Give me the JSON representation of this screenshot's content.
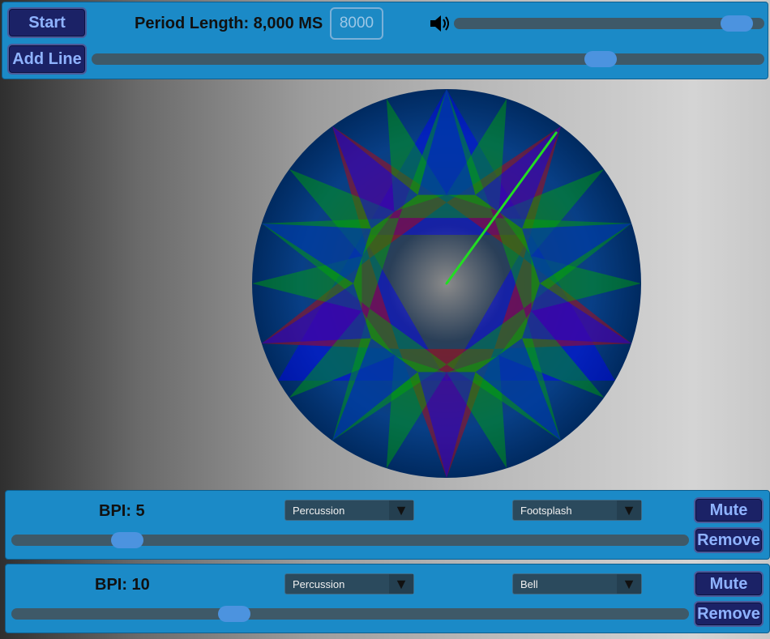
{
  "toolbar": {
    "start_label": "Start",
    "add_line_label": "Add Line",
    "period_label": "Period Length: 8,000 MS",
    "period_value": "8000",
    "volume_level": 0.96,
    "period_slider_level": 0.77
  },
  "lines": [
    {
      "bpi_label": "BPI: 5",
      "category": "Percussion",
      "sound": "Footsplash",
      "mute_label": "Mute",
      "remove_label": "Remove",
      "slider_level": 0.155
    },
    {
      "bpi_label": "BPI: 10",
      "category": "Percussion",
      "sound": "Bell",
      "mute_label": "Mute",
      "remove_label": "Remove",
      "slider_level": 0.32
    }
  ],
  "visual": {
    "star_colors": [
      "#0000ff",
      "#00aa00",
      "#cc0000"
    ],
    "disc_color": "#003a78",
    "hand_color": "#22dd22"
  }
}
